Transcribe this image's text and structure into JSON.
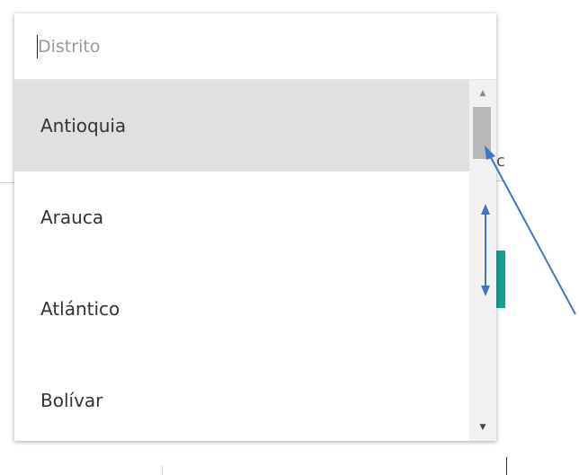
{
  "dropdown": {
    "search": {
      "placeholder": "Distrito",
      "value": ""
    },
    "options": [
      {
        "label": "Antioquia",
        "highlighted": true
      },
      {
        "label": "Arauca",
        "highlighted": false
      },
      {
        "label": "Atlántico",
        "highlighted": false
      },
      {
        "label": "Bolívar",
        "highlighted": false
      }
    ],
    "scrollbar": {
      "up_arrow": "▲",
      "down_arrow": "▼"
    }
  },
  "background": {
    "partial_char": "c"
  },
  "annotation": {
    "color": "#4472c4"
  },
  "colors": {
    "highlight": "#e0e0e0",
    "accent_teal": "#16a196"
  }
}
